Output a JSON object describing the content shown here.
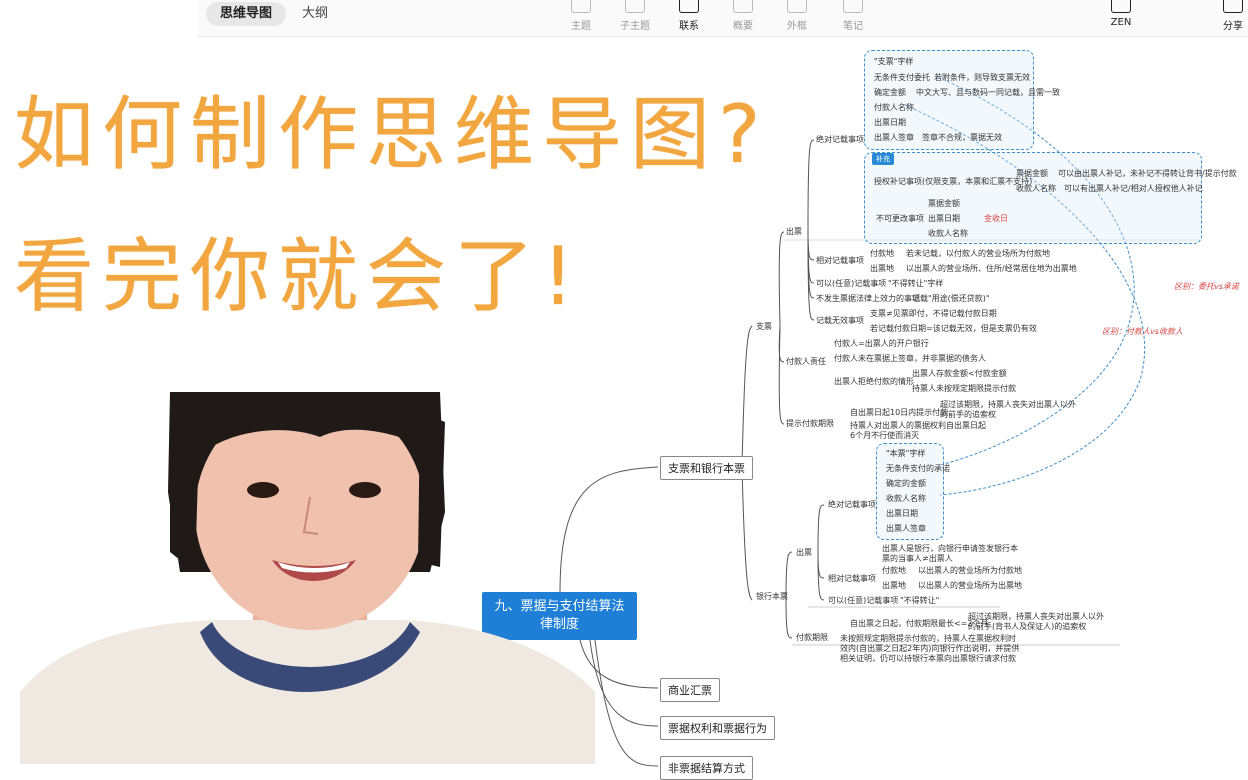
{
  "toolbar": {
    "tabs": [
      "思维导图",
      "大纲"
    ],
    "tools": [
      "主题",
      "子主题",
      "联系",
      "概要",
      "外框",
      "笔记"
    ],
    "zen": "ZEN",
    "share": "分享"
  },
  "headline": {
    "line1": "如何制作思维导图?",
    "line2": "看完你就会了!"
  },
  "mindmap": {
    "root": "九、票据与支付结算法律制度",
    "root_line1": "九、票据与支付结算法",
    "root_line2": "律制度",
    "branches": [
      "支票和银行本票",
      "商业汇票",
      "票据权利和票据行为",
      "非票据结算方式"
    ],
    "check": {
      "label": "支票",
      "issue": "出票",
      "absolute_items": "绝对记载事项",
      "abs": [
        "\"支票\"字样",
        "无条件支付委托",
        "若附条件，则导致支票无效",
        "确定金额",
        "中文大写、且与数码一同记载，且需一致",
        "付款人名称",
        "出票日期",
        "出票人签章",
        "签章不合规，票据无效"
      ],
      "supplement_tag": "补充",
      "authorized": "授权补记事项(仅限支票，本票和汇票不支持)",
      "amount": "票据金额",
      "amount_note": "可以由出票人补记，未补记不得转让背书/提示付款",
      "payee": "收款人名称",
      "payee_note": "可以有出票人补记/相对人授权他人补记",
      "nochange": "不可更改事项",
      "nc": [
        "票据金额",
        "出票日期",
        "收款人名称"
      ],
      "nc_note": "金收日",
      "relative": "相对记载事项",
      "rel": [
        "付款地",
        "若未记载，以付款人的营业场所为付款地",
        "出票地",
        "以出票人的营业场所、住所/经常居住地为出票地"
      ],
      "optional": "可以(任意)记载事项",
      "optional_note": "\"不得转让\"字样",
      "noeffect": "不发生票据法律上效力的事项",
      "noeffect_note": "记载\"用途(偿还贷款)\"",
      "invalid": "记载无效事项",
      "inv": [
        "支票≠见票即付，不得记载付款日期",
        "若记载付款日期=该记载无效，但是支票仍有效"
      ],
      "payer_resp": "付款人责任",
      "pr": [
        "付款人=出票人的开户银行",
        "付款人未在票据上签章，并非票据的债务人",
        "出票人拒绝付款的情形",
        "出票人存款金额<付款金额",
        "持票人未按规定期限提示付款"
      ],
      "period": "提示付款期限",
      "pe": [
        "自出票日起10日内提示付款",
        "超过该期限，持票人丧失对出票人以外的前手的追索权",
        "持票人对出票人的票据权利自出票日起6个月不行使而消灭"
      ],
      "diff1": "区别：委托vs承诺",
      "diff2": "区别：付款人vs收款人"
    },
    "note": {
      "label": "银行本票",
      "issue": "出票",
      "absolute_items": "绝对记载事项",
      "abs": [
        "\"本票\"字样",
        "无条件支付的承诺",
        "确定的金额",
        "收款人名称",
        "出票日期",
        "出票人签章"
      ],
      "issuer": "出票人是银行，向银行申请签发银行本票的当事人≠出票人",
      "relative": "相对记载事项",
      "rel": [
        "付款地",
        "以出票人的营业场所为付款地",
        "出票地",
        "以出票人的营业场所为出票地"
      ],
      "optional": "可以(任意)记载事项",
      "optional_note": "\"不得转让\"",
      "period": "付款期限",
      "pe": [
        "自出票之日起，付款期限最长<=2个月",
        "超过该期限，持票人丧失对出票人以外的前手(背书人及保证人)的追索权",
        "未按照规定期限提示付款的，持票人在票据权利时效内(自出票之日起2年内)向银行作出说明，并提供相关证明，仍可以持银行本票向出票银行请求付款"
      ]
    }
  },
  "colors": {
    "headline": "#f2a640",
    "root_bg": "#1f7fd6",
    "relation": "#3d8ec9",
    "sweater": "#efe9e1",
    "collar": "#3a4a78"
  }
}
